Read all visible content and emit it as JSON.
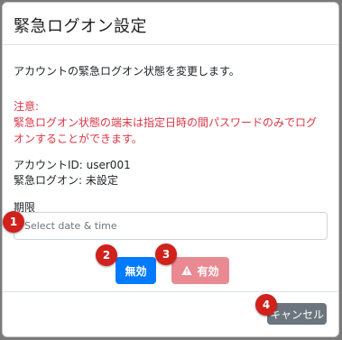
{
  "modal": {
    "title": "緊急ログオン設定",
    "description": "アカウントの緊急ログオン状態を変更します。",
    "notice_heading": "注意:",
    "notice_line1": "緊急ログオン状態の端末は指定日時の間パスワードのみでログ",
    "notice_line2": "オンすることができます。",
    "account_id": "アカウントID: user001",
    "emergency_status": "緊急ログオン: 未設定",
    "deadline_label": "期限",
    "deadline_placeholder": "Select date & time",
    "disable_label": "無効",
    "enable_label": "有効",
    "cancel_label": "キャンセル"
  },
  "badges": [
    "1",
    "2",
    "3",
    "4"
  ],
  "colors": {
    "primary": "#007bff",
    "danger": "#e98a92",
    "secondary": "#6c757d",
    "badge": "#d0211c",
    "notice_text": "#dc3545"
  },
  "icons": {
    "enable_button_icon": "warning-triangle-icon"
  }
}
